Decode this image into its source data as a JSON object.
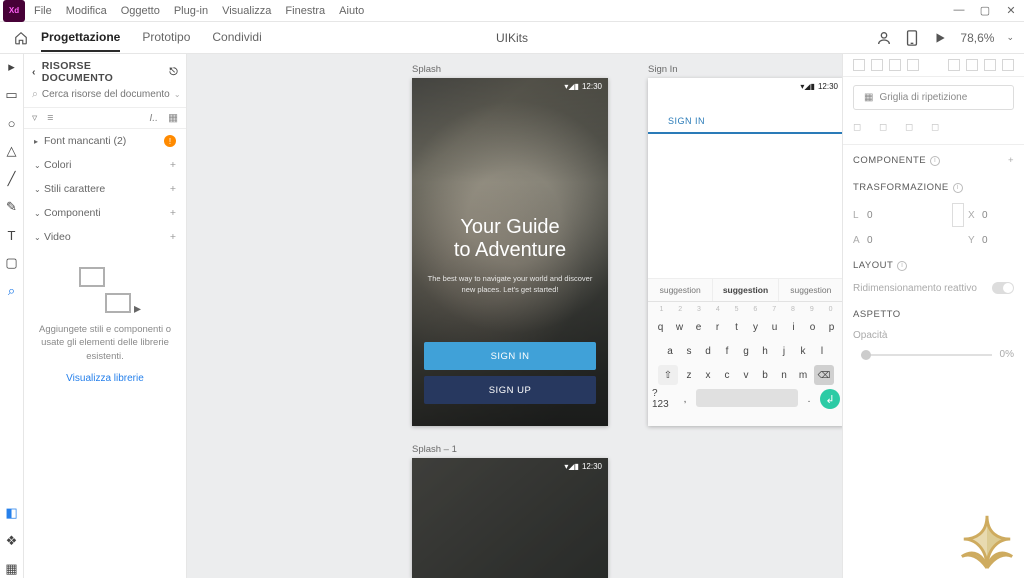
{
  "menu": {
    "file": "File",
    "edit": "Modifica",
    "object": "Oggetto",
    "plugin": "Plug-in",
    "view": "Visualizza",
    "window": "Finestra",
    "help": "Aiuto"
  },
  "tabs": {
    "design": "Progettazione",
    "prototype": "Prototipo",
    "share": "Condividi"
  },
  "doc_title": "UIKits",
  "zoom": "78,6%",
  "left": {
    "title": "RISORSE DOCUMENTO",
    "search_placeholder": "Cerca risorse del documento",
    "font": "Font mancanti (2)",
    "colori": "Colori",
    "stili": "Stili carattere",
    "componenti": "Componenti",
    "video": "Video",
    "empty": "Aggiungete stili e componenti o usate gli elementi delle librerie esistenti.",
    "lib_link": "Visualizza librerie"
  },
  "artboards": {
    "splash": "Splash",
    "signin": "Sign In",
    "splash1": "Splash – 1",
    "time": "12:30",
    "headline_l1": "Your Guide",
    "headline_l2": "to Adventure",
    "sub": "The best way to navigate your world and discover new places. Let's get started!",
    "btn_signin": "SIGN IN",
    "btn_signup": "SIGN UP",
    "tab_signin": "SIGN IN",
    "suggestion": "suggestion",
    "keyboard": {
      "nums": [
        "1",
        "2",
        "3",
        "4",
        "5",
        "6",
        "7",
        "8",
        "9",
        "0"
      ],
      "row1": [
        "q",
        "w",
        "e",
        "r",
        "t",
        "y",
        "u",
        "i",
        "o",
        "p"
      ],
      "row2": [
        "a",
        "s",
        "d",
        "f",
        "g",
        "h",
        "j",
        "k",
        "l"
      ],
      "row3": [
        "z",
        "x",
        "c",
        "v",
        "b",
        "n",
        "m"
      ],
      "mode": "?123"
    }
  },
  "inspector": {
    "grid": "Griglia di ripetizione",
    "comp": "COMPONENTE",
    "transform": "TRASFORMAZIONE",
    "l": "L",
    "l_v": "0",
    "x": "X",
    "x_v": "0",
    "a": "A",
    "a_v": "0",
    "y": "Y",
    "y_v": "0",
    "layout": "LAYOUT",
    "responsive": "Ridimensionamento reattivo",
    "aspect": "ASPETTO",
    "opacity": "Opacità",
    "opacity_v": "0%"
  }
}
